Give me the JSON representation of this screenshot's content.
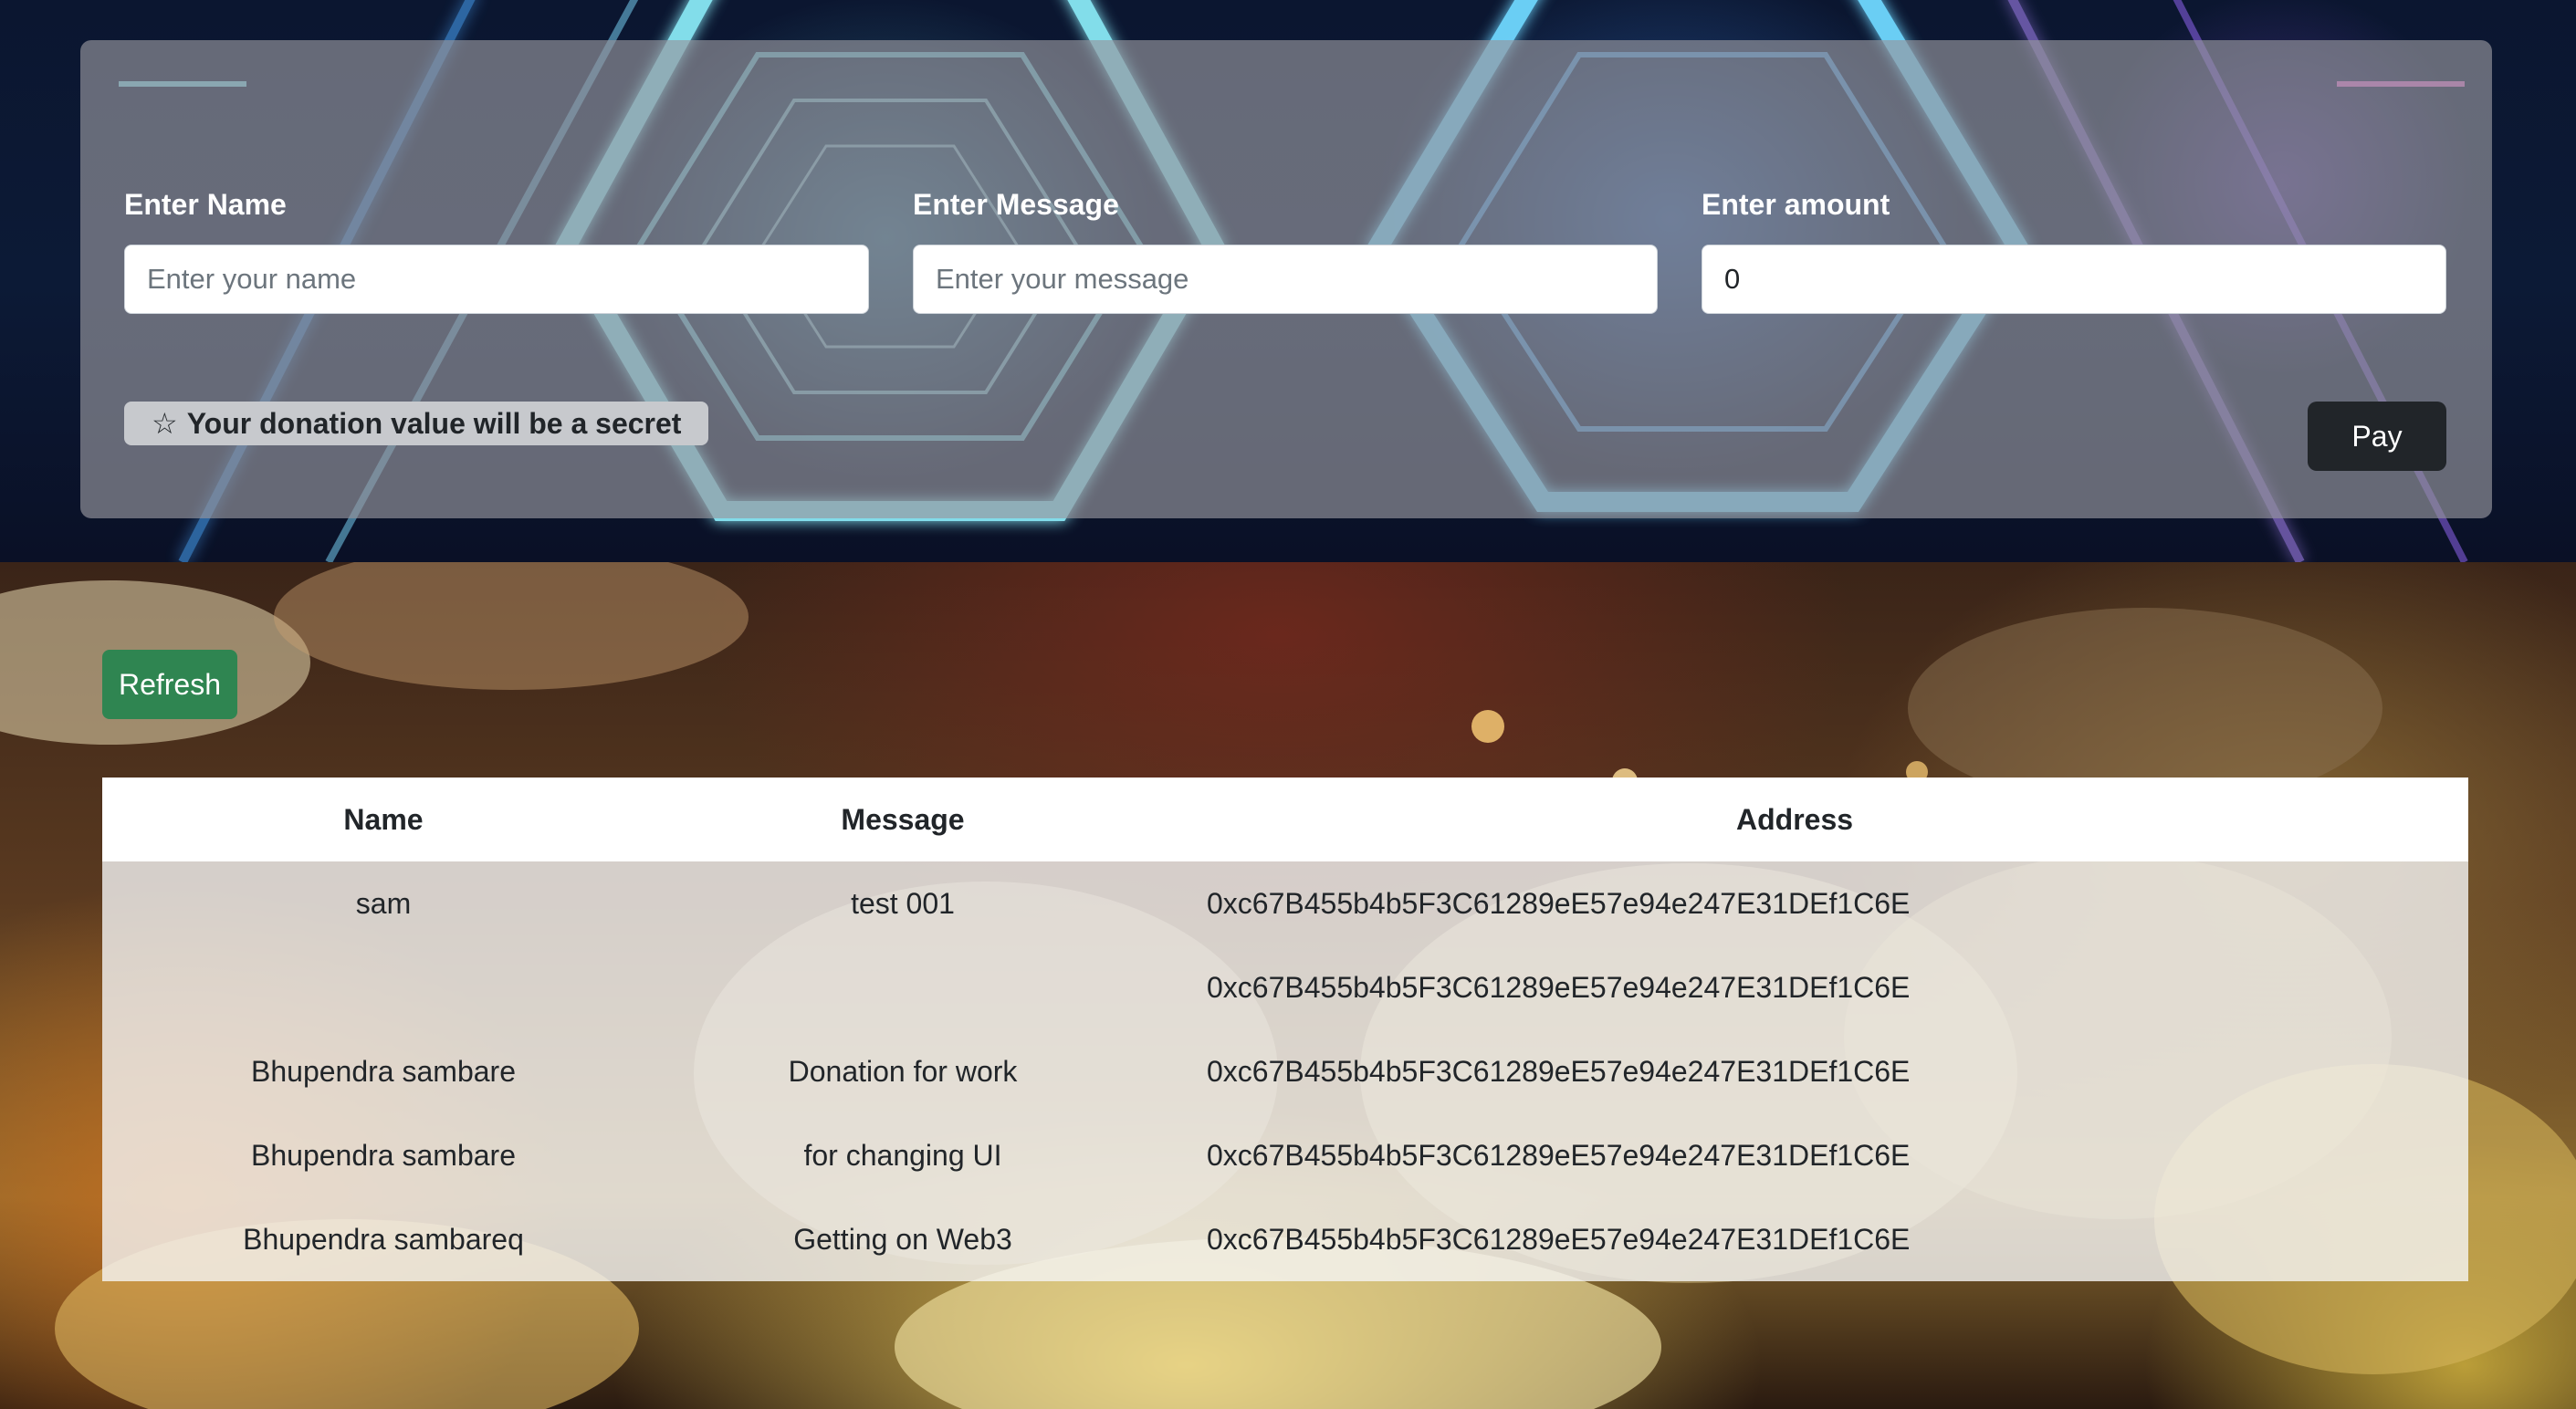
{
  "form": {
    "fields": [
      {
        "label": "Enter Name",
        "placeholder": "Enter your name",
        "value": ""
      },
      {
        "label": "Enter Message",
        "placeholder": "Enter your message",
        "value": ""
      },
      {
        "label": "Enter amount",
        "placeholder": "",
        "value": "0"
      }
    ],
    "secret_notice": "Your donation value will be a secret",
    "secret_icon": "☆",
    "pay_label": "Pay"
  },
  "donations": {
    "refresh_label": "Refresh",
    "columns": [
      "Name",
      "Message",
      "Address"
    ],
    "rows": [
      {
        "name": "sam",
        "message": "test 001",
        "address": "0xc67B455b4b5F3C61289eE57e94e247E31DEf1C6E"
      },
      {
        "name": "",
        "message": "",
        "address": "0xc67B455b4b5F3C61289eE57e94e247E31DEf1C6E"
      },
      {
        "name": "Bhupendra sambare",
        "message": "Donation for work",
        "address": "0xc67B455b4b5F3C61289eE57e94e247E31DEf1C6E"
      },
      {
        "name": "Bhupendra sambare",
        "message": "for changing UI",
        "address": "0xc67B455b4b5F3C61289eE57e94e247E31DEf1C6E"
      },
      {
        "name": "Bhupendra sambareq",
        "message": "Getting on Web3",
        "address": "0xc67B455b4b5F3C61289eE57e94e247E31DEf1C6E"
      }
    ]
  },
  "colors": {
    "pay_button": "#212529",
    "refresh_button": "#2f8551",
    "card_overlay": "#96969e"
  }
}
